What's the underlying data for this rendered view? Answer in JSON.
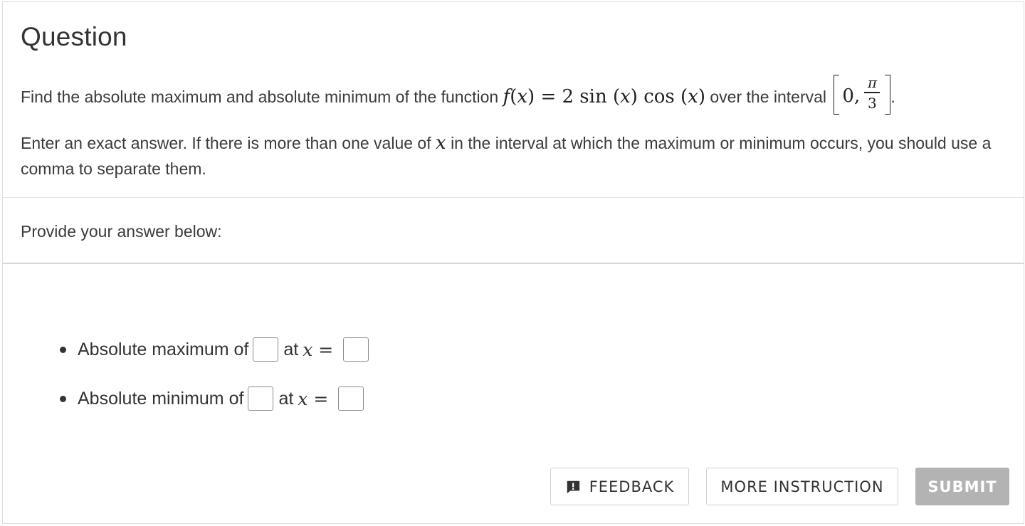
{
  "question": {
    "title": "Question",
    "prompt_prefix": "Find the absolute maximum and absolute minimum of the function",
    "function_expression": "f(x) = 2 sin (x) cos (x)",
    "prompt_middle": "over the interval",
    "interval_start": "0,",
    "interval_end_numerator": "π",
    "interval_end_denominator": "3",
    "prompt_end": ".",
    "instruction_part1": "Enter an exact answer. If there is more than one value of",
    "instruction_var": "x",
    "instruction_part2": "in the interval at which the maximum or minimum occurs, you should use a comma to separate them."
  },
  "answer_section": {
    "header": "Provide your answer below:"
  },
  "answers": [
    {
      "label": "Absolute maximum of",
      "at": "at",
      "var": "x",
      "eq": "=",
      "value": "",
      "x_value": ""
    },
    {
      "label": "Absolute minimum of",
      "at": "at",
      "var": "x",
      "eq": "=",
      "value": "",
      "x_value": ""
    }
  ],
  "buttons": {
    "feedback": "FEEDBACK",
    "more_instruction": "MORE INSTRUCTION",
    "submit": "SUBMIT"
  },
  "icons": {
    "feedback": "comment-alert-icon"
  },
  "colors": {
    "submit_disabled_bg": "#b3b3b3",
    "text": "#3b3b3b"
  }
}
